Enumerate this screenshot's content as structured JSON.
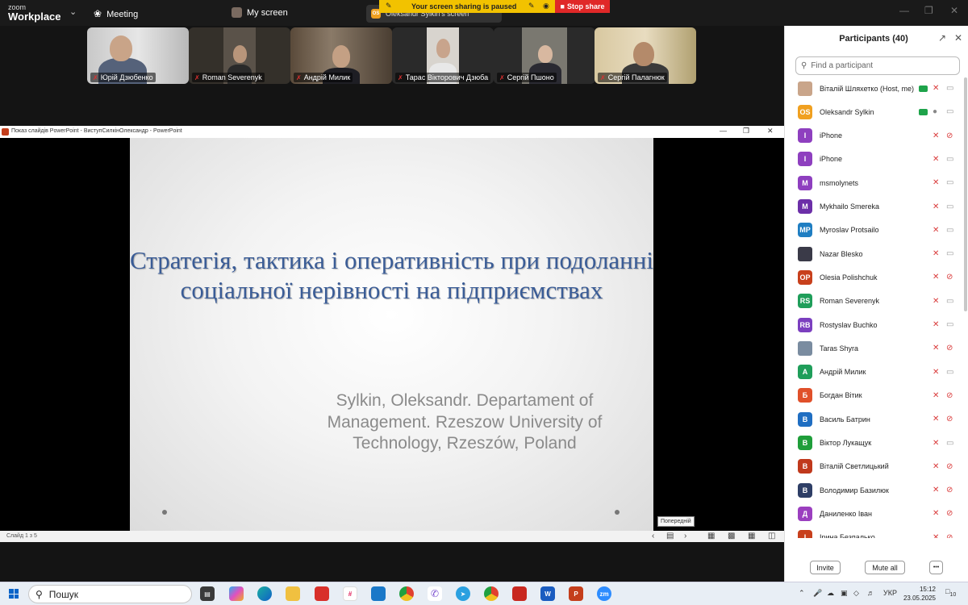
{
  "app": {
    "logo_top": "zoom",
    "logo_bottom": "Workplace"
  },
  "topbar": {
    "meeting_label": "Meeting",
    "myscreen_label": "My screen",
    "sharing_status": "Your screen sharing is paused",
    "stop_share_label": "Stop share",
    "share_source_label": "Oleksandr Sylkin's screen",
    "share_source_badge": "OS"
  },
  "video_tiles": [
    {
      "name": "Юрій Дзюбенко"
    },
    {
      "name": "Roman Severenyk"
    },
    {
      "name": "Андрій Милик"
    },
    {
      "name": "Тарас Вікторович Дзюба"
    },
    {
      "name": "Сергій Пшоно"
    },
    {
      "name": "Сергій Палагнюк"
    }
  ],
  "ppt": {
    "window_title": "Показ слайдів PowerPoint  -  ВиступСилкінОлександр - PowerPoint",
    "slide_title": "Стратегія, тактика і оперативність при подоланні соціальної нерівності на підприємствах",
    "slide_author": "Sylkin, Oleksandr.   Departament of\nManagement. Rzeszow University of\nTechnology, Rzeszów, Poland",
    "status": "Слайд 1 з 5",
    "tooltip": "Попередній"
  },
  "participants": {
    "title": "Participants (40)",
    "search_placeholder": "Find a participant",
    "invite_label": "Invite",
    "mute_all_label": "Mute all",
    "more_label": "•••",
    "items": [
      {
        "name": "Віталій Шляхетко (Host, me)",
        "initials": "",
        "color": "#c9a58a",
        "photo": true,
        "share": true,
        "mic": "off",
        "cam": "on"
      },
      {
        "name": "Oleksandr Sylkin",
        "initials": "OS",
        "color": "#f0a020",
        "share": true,
        "mic": "on",
        "cam": "on"
      },
      {
        "name": "iPhone",
        "initials": "I",
        "color": "#8e3fbf",
        "mic": "off",
        "cam": "off"
      },
      {
        "name": "iPhone",
        "initials": "I",
        "color": "#8e3fbf",
        "mic": "off",
        "cam": "on"
      },
      {
        "name": "msmolynets",
        "initials": "M",
        "color": "#8e3fbf",
        "mic": "off",
        "cam": "on"
      },
      {
        "name": "Mykhailo Smereka",
        "initials": "M",
        "color": "#6c2fa8",
        "mic": "off",
        "cam": "on"
      },
      {
        "name": "Myroslav Protsailo",
        "initials": "MP",
        "color": "#1f7ec2",
        "mic": "off",
        "cam": "on"
      },
      {
        "name": "Nazar Blesko",
        "initials": "",
        "color": "#3a3a48",
        "photo": true,
        "mic": "off",
        "cam": "on"
      },
      {
        "name": "Olesia Polishchuk",
        "initials": "OP",
        "color": "#c8401c",
        "mic": "off",
        "cam": "off"
      },
      {
        "name": "Roman Severenyk",
        "initials": "RS",
        "color": "#1f9e5a",
        "mic": "off",
        "cam": "on"
      },
      {
        "name": "Rostyslav Buchko",
        "initials": "RB",
        "color": "#7b3fbf",
        "mic": "off",
        "cam": "on"
      },
      {
        "name": "Taras Shyra",
        "initials": "",
        "color": "#7a8ca0",
        "photo": true,
        "mic": "off",
        "cam": "off"
      },
      {
        "name": "Андрій Милик",
        "initials": "А",
        "color": "#1f9e5a",
        "mic": "off",
        "cam": "on"
      },
      {
        "name": "Богдан Вітик",
        "initials": "Б",
        "color": "#e0502a",
        "mic": "off",
        "cam": "off"
      },
      {
        "name": "Василь Батрин",
        "initials": "В",
        "color": "#1f6ec2",
        "mic": "off",
        "cam": "off"
      },
      {
        "name": "Віктор Лукащук",
        "initials": "В",
        "color": "#1f9e3a",
        "mic": "off",
        "cam": "on"
      },
      {
        "name": "Віталій Светлицький",
        "initials": "В",
        "color": "#c0391c",
        "mic": "off",
        "cam": "off"
      },
      {
        "name": "Володимир Базилюк",
        "initials": "В",
        "color": "#2e3e66",
        "mic": "off",
        "cam": "off"
      },
      {
        "name": "Даниленко Іван",
        "initials": "Д",
        "color": "#9b3fbf",
        "mic": "off",
        "cam": "off"
      },
      {
        "name": "Ірина Безпалько",
        "initials": "І",
        "color": "#c8401c",
        "mic": "off",
        "cam": "off"
      }
    ]
  },
  "taskbar": {
    "search_label": "Пошук",
    "lang": "УКР",
    "time": "15:12",
    "date": "23.05.2025",
    "notif_count": "10",
    "apps": [
      "task-view",
      "copilot",
      "edge",
      "file-explorer",
      "app-red",
      "slack",
      "app-blue",
      "chrome",
      "viber",
      "telegram",
      "chrome-2",
      "app-red-2",
      "word",
      "powerpoint",
      "zoom"
    ]
  }
}
